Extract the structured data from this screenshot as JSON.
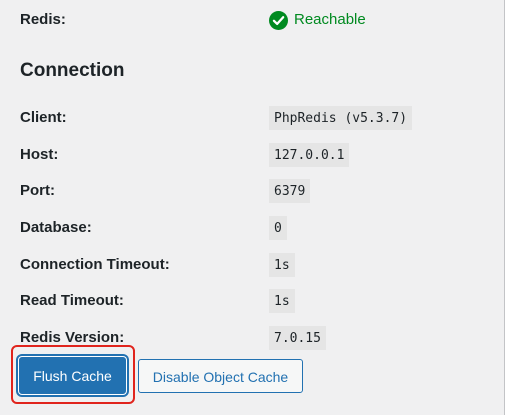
{
  "status": {
    "label": "Redis:",
    "value": "Reachable",
    "icon": "check-circle-icon",
    "color": "#008a20"
  },
  "connection": {
    "title": "Connection",
    "rows": [
      {
        "label": "Client:",
        "value": "PhpRedis (v5.3.7)"
      },
      {
        "label": "Host:",
        "value": "127.0.0.1"
      },
      {
        "label": "Port:",
        "value": "6379"
      },
      {
        "label": "Database:",
        "value": "0"
      },
      {
        "label": "Connection Timeout:",
        "value": "1s"
      },
      {
        "label": "Read Timeout:",
        "value": "1s"
      },
      {
        "label": "Redis Version:",
        "value": "7.0.15"
      }
    ]
  },
  "actions": {
    "flush_label": "Flush Cache",
    "disable_label": "Disable Object Cache",
    "primary_color": "#2271b1",
    "highlight_color": "#e0241d"
  }
}
